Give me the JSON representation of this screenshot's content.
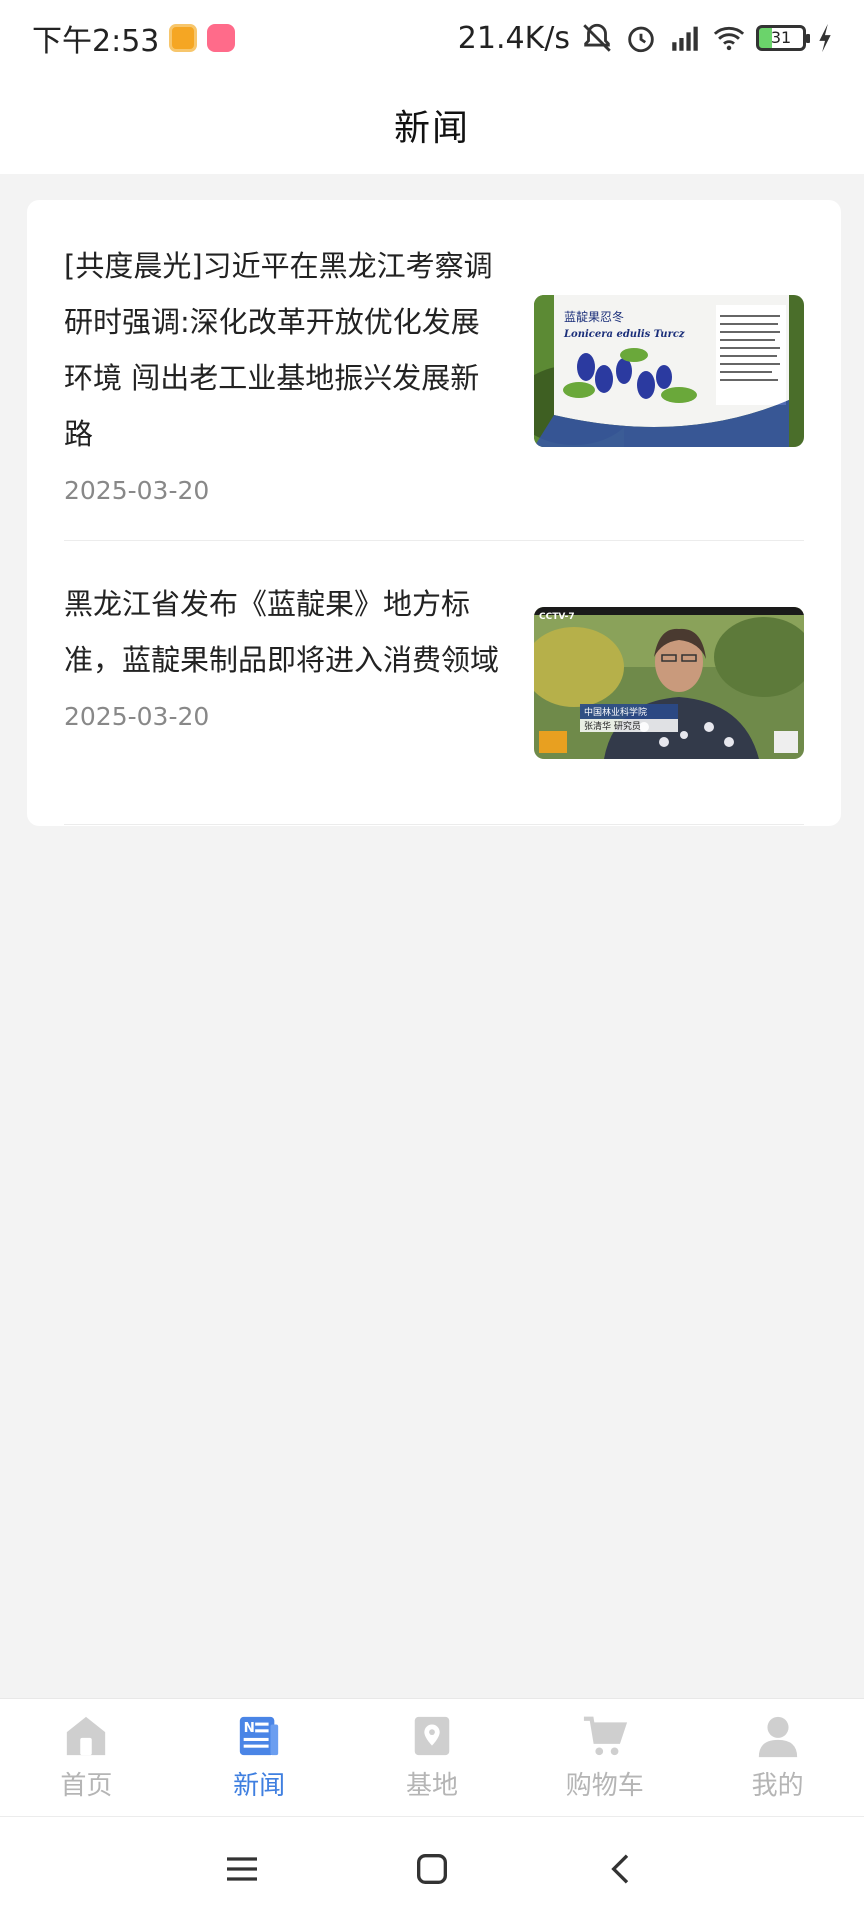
{
  "status_bar": {
    "time": "下午2:53",
    "net_speed": "21.4K/s",
    "battery": "31",
    "icons": [
      "notification-app-icon",
      "notification-app2-icon",
      "mute-bell-icon",
      "alarm-icon",
      "hd-signal-icon",
      "wifi-icon",
      "battery-icon",
      "charging-icon"
    ]
  },
  "header": {
    "title": "新闻"
  },
  "news": [
    {
      "title": "[共度晨光]习近平在黑龙江考察调研时强调:深化改革开放优化发展环境 闯出老工业基地振兴发展新路",
      "date": "2025-03-20",
      "thumbnail": {
        "heading": "蓝靛果忍冬",
        "subheading": "Lonicera edulis Turcz"
      }
    },
    {
      "title": "黑龙江省发布《蓝靛果》地方标准，蓝靛果制品即将进入消费领域",
      "date": "2025-03-20",
      "thumbnail": {
        "logo": "CCTV-7",
        "caption_line1": "中国林业科学院",
        "caption_line2": "张清华 研究员"
      }
    }
  ],
  "bottom_nav": [
    {
      "label": "首页",
      "icon": "home-icon",
      "active": false
    },
    {
      "label": "新闻",
      "icon": "news-icon",
      "active": true
    },
    {
      "label": "基地",
      "icon": "base-map-icon",
      "active": false
    },
    {
      "label": "购物车",
      "icon": "cart-icon",
      "active": false
    },
    {
      "label": "我的",
      "icon": "user-icon",
      "active": false
    }
  ],
  "colors": {
    "accent": "#3f7fe0",
    "inactive": "#b5b5b5",
    "background": "#f3f3f3"
  }
}
